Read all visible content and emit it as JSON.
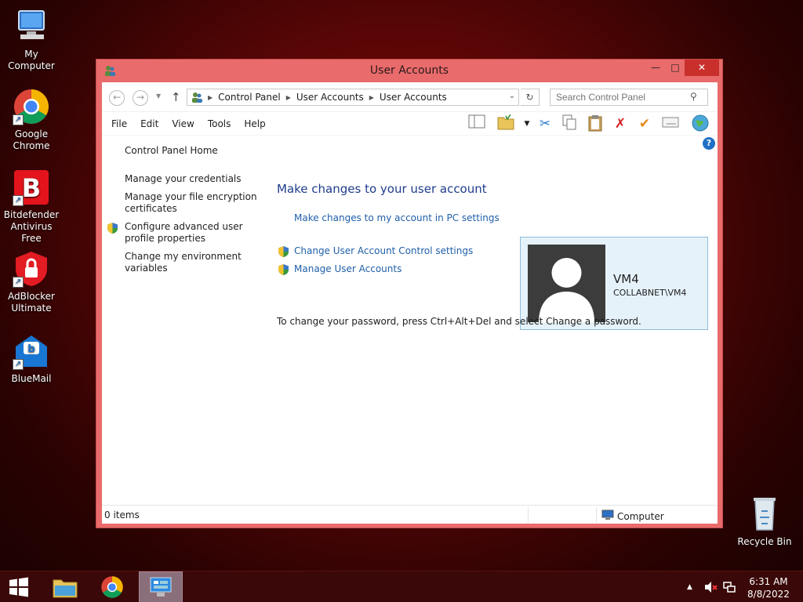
{
  "desktop": {
    "icons": [
      {
        "label": "My Computer"
      },
      {
        "label": "Google Chrome"
      },
      {
        "label": "Bitdefender Antivirus Free"
      },
      {
        "label": "AdBlocker Ultimate"
      },
      {
        "label": "BlueMail"
      },
      {
        "label": "Recycle Bin"
      }
    ]
  },
  "window": {
    "title": "User Accounts",
    "address": {
      "crumbs": [
        "Control Panel",
        "User Accounts",
        "User Accounts"
      ]
    },
    "search": {
      "placeholder": "Search Control Panel"
    },
    "menu": [
      "File",
      "Edit",
      "View",
      "Tools",
      "Help"
    ],
    "leftnav": [
      "Control Panel Home",
      "Manage your credentials",
      "Manage your file encryption certificates",
      "Configure advanced user profile properties",
      "Change my environment variables"
    ],
    "main": {
      "title": "Make changes to your user account",
      "tasks": [
        "Make changes to my account in PC settings",
        "Change User Account Control settings",
        "Manage User Accounts"
      ],
      "account": {
        "name": "VM4",
        "domain": "COLLABNET\\VM4"
      },
      "note": "To change your password, press Ctrl+Alt+Del and select Change a password."
    },
    "status": {
      "items": "0 items",
      "location": "Computer"
    }
  },
  "taskbar": {
    "time": "6:31 AM",
    "date": "8/8/2022"
  },
  "colors": {
    "window_frame": "#e96b6b",
    "link": "#1f5fa8",
    "title_blue": "#1e3d8a",
    "close_button": "#c9302c"
  }
}
